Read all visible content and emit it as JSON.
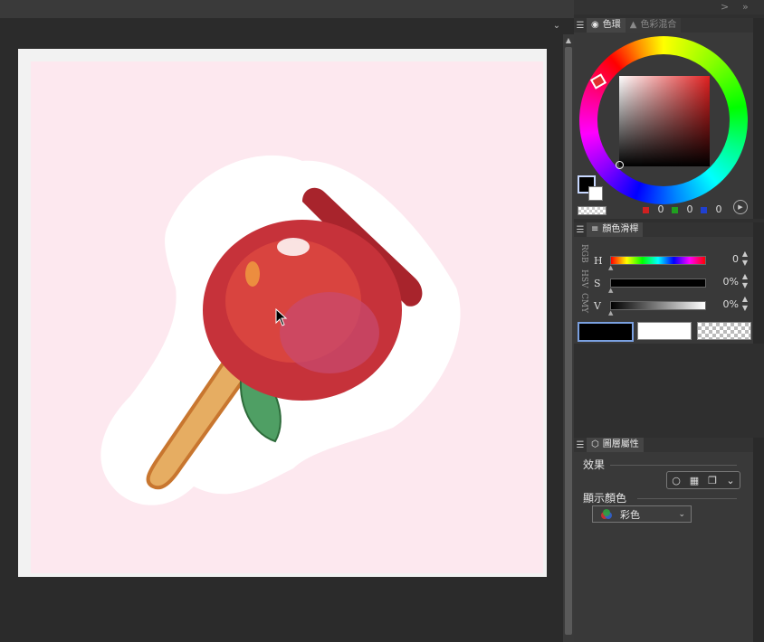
{
  "window": {
    "nav": {
      "right_arrow": ">",
      "double_arrow": "»"
    }
  },
  "tabstrip": {
    "chevron": "⌄"
  },
  "canvas": {
    "background_color": "#fde8ef",
    "artwork": "candy-apple-illustration"
  },
  "color_wheel_panel": {
    "tabs": [
      {
        "label": "色環",
        "icon": "color-wheel-icon",
        "active": true
      },
      {
        "label": "色彩混合",
        "icon": "color-mix-icon",
        "active": false
      }
    ],
    "main_color": "#000000",
    "sub_color": "#ffffff",
    "hue_color": "#e02020",
    "rgb": [
      {
        "channel": "R",
        "color": "#d02020",
        "value": "0"
      },
      {
        "channel": "G",
        "color": "#20a020",
        "value": "0"
      },
      {
        "channel": "B",
        "color": "#2040d0",
        "value": "0"
      }
    ]
  },
  "color_slider_panel": {
    "tab_label": "顏色滑桿",
    "modes": [
      "RGB",
      "HSV",
      "CMY"
    ],
    "sliders": [
      {
        "letter": "H",
        "value": "0"
      },
      {
        "letter": "S",
        "value": "0%"
      },
      {
        "letter": "V",
        "value": "0%"
      }
    ],
    "swatches": [
      "#000000",
      "#ffffff",
      "transparent"
    ]
  },
  "layer_property_panel": {
    "tab_label": "圖層屬性",
    "effect_label": "效果",
    "display_color_label": "顯示顏色",
    "display_color_value": "彩色"
  }
}
